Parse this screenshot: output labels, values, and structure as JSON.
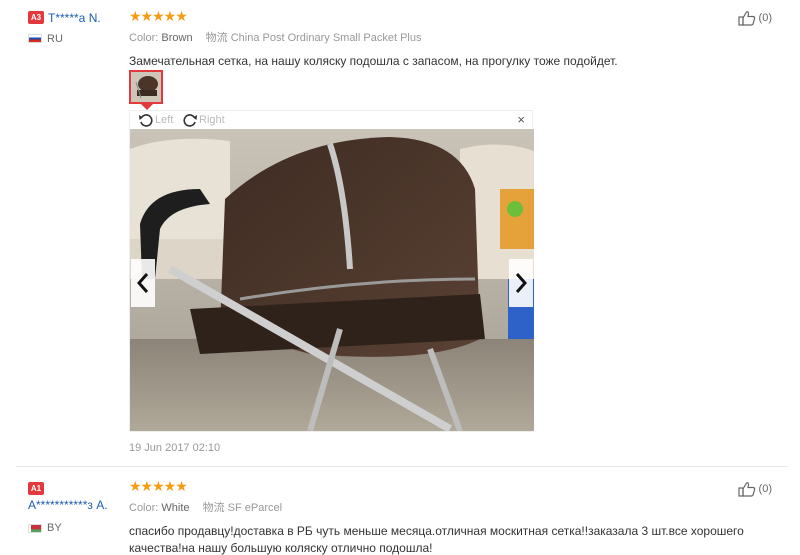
{
  "reviews": [
    {
      "level": "A3",
      "user": "T*****a N.",
      "country": "RU",
      "stars": "★★★★★",
      "color_label": "Color:",
      "color_value": "Brown",
      "shipping_label": "物流",
      "shipping_value": "China Post Ordinary Small Packet Plus",
      "text": "Замечательная сетка, на нашу коляску подошла с запасом, на прогулку тоже подойдет.",
      "likes": "(0)",
      "date": "19 Jun 2017 02:10",
      "rotate_left": "Left",
      "rotate_right": "Right",
      "close": "×"
    },
    {
      "level": "A1",
      "user": "A***********з А.",
      "country": "BY",
      "stars": "★★★★★",
      "color_label": "Color:",
      "color_value": "White",
      "shipping_label": "物流",
      "shipping_value": "SF eParcel",
      "text": "спасибо продавцу!доставка в РБ чуть меньше месяца.отличная москитная сетка!!заказала 3 шт.все хорошего качества!на нашу большую коляску отлично подошла!",
      "likes": "(0)"
    }
  ],
  "colors": {
    "accent": "#e4393c",
    "star": "#f69b12",
    "link": "#1b5fae"
  },
  "icons": [
    "thumbs-up-icon",
    "rotate-left-icon",
    "rotate-right-icon",
    "close-icon",
    "chevron-left-icon",
    "chevron-right-icon",
    "flag-icon"
  ]
}
